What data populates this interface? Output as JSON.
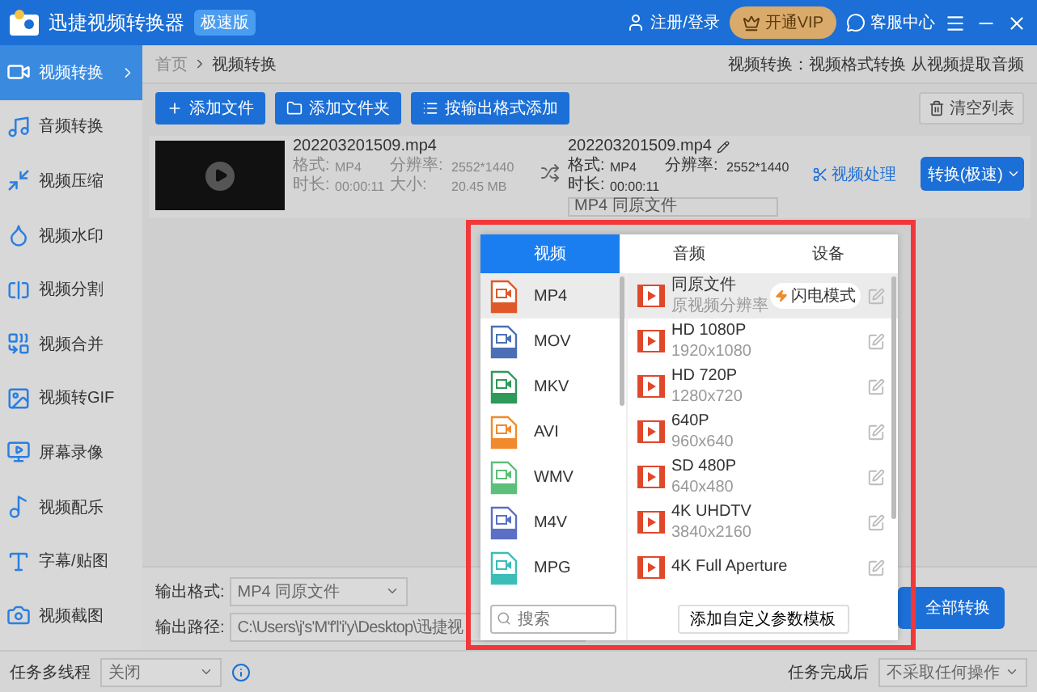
{
  "window": {
    "title": "迅捷视频转换器",
    "edition_badge": "极速版",
    "login": "注册/登录",
    "vip": "开通VIP",
    "support": "客服中心"
  },
  "sidebar": {
    "items": [
      {
        "label": "视频转换",
        "selected": true,
        "kind": "video"
      },
      {
        "label": "音频转换",
        "selected": false,
        "kind": "audio"
      },
      {
        "label": "视频压缩",
        "selected": false,
        "kind": "compress"
      },
      {
        "label": "视频水印",
        "selected": false,
        "kind": "watermark"
      },
      {
        "label": "视频分割",
        "selected": false,
        "kind": "split"
      },
      {
        "label": "视频合并",
        "selected": false,
        "kind": "merge"
      },
      {
        "label": "视频转GIF",
        "selected": false,
        "kind": "gif"
      },
      {
        "label": "屏幕录像",
        "selected": false,
        "kind": "record"
      },
      {
        "label": "视频配乐",
        "selected": false,
        "kind": "music"
      },
      {
        "label": "字幕/贴图",
        "selected": false,
        "kind": "subtitle"
      },
      {
        "label": "视频截图",
        "selected": false,
        "kind": "screenshot"
      }
    ]
  },
  "breadcrumb": {
    "home": "首页",
    "current": "视频转换",
    "hint": "视频转换：视频格式转换 从视频提取音频"
  },
  "toolbar": {
    "buttons": [
      {
        "label": "添加文件",
        "kind": "plus"
      },
      {
        "label": "添加文件夹",
        "kind": "folder"
      },
      {
        "label": "按输出格式添加",
        "kind": "list"
      }
    ],
    "clear": "清空列表"
  },
  "file": {
    "name": "202203201509.mp4",
    "format_label": "格式:",
    "format": "MP4",
    "resolution_label": "分辨率:",
    "resolution": "2552*1440",
    "duration_label": "时长:",
    "duration": "00:00:11",
    "size_label": "大小:",
    "size": "20.45 MB",
    "output_name": "202203201509.mp4",
    "output_format_label": "格式:",
    "output_format": "MP4",
    "output_resolution_label": "分辨率:",
    "output_resolution": "2552*1440",
    "output_duration_label": "时长:",
    "output_duration": "00:00:11",
    "output_preset": "MP4  同原文件",
    "process": "视频处理",
    "convert": "转换(极速)"
  },
  "output": {
    "format_label": "输出格式:",
    "format": "MP4  同原文件",
    "path_label": "输出路径:",
    "path": "C:\\Users\\j's'M'f'l'i'y\\Desktop\\迅捷视",
    "convert_all": "全部转换"
  },
  "status_bar": {
    "threads_label": "任务多线程",
    "threads": "关闭",
    "after_label": "任务完成后",
    "after": "不采取任何操作"
  },
  "format_popup": {
    "tabs": [
      {
        "label": "视频",
        "selected": true
      },
      {
        "label": "音频",
        "selected": false
      },
      {
        "label": "设备",
        "selected": false
      }
    ],
    "formats": [
      {
        "label": "MP4",
        "selected": true,
        "color": "#e0582a"
      },
      {
        "label": "MOV",
        "selected": false,
        "color": "#4a6fb5"
      },
      {
        "label": "MKV",
        "selected": false,
        "color": "#2e9a5a"
      },
      {
        "label": "AVI",
        "selected": false,
        "color": "#f08a2c"
      },
      {
        "label": "WMV",
        "selected": false,
        "color": "#5cbf7a"
      },
      {
        "label": "M4V",
        "selected": false,
        "color": "#5b6fc4"
      },
      {
        "label": "MPG",
        "selected": false,
        "color": "#3bbdb8"
      }
    ],
    "presets": [
      {
        "name": "同原文件",
        "detail": "原视频分辨率",
        "badge": "闪电模式",
        "selected": true
      },
      {
        "name": "HD 1080P",
        "detail": "1920x1080",
        "selected": false
      },
      {
        "name": "HD 720P",
        "detail": "1280x720",
        "selected": false
      },
      {
        "name": "640P",
        "detail": "960x640",
        "selected": false
      },
      {
        "name": "SD 480P",
        "detail": "640x480",
        "selected": false
      },
      {
        "name": "4K UHDTV",
        "detail": "3840x2160",
        "selected": false
      },
      {
        "name": "4K Full Aperture",
        "selected": false
      }
    ],
    "search_placeholder": "搜索",
    "add_template": "添加自定义参数模板"
  }
}
